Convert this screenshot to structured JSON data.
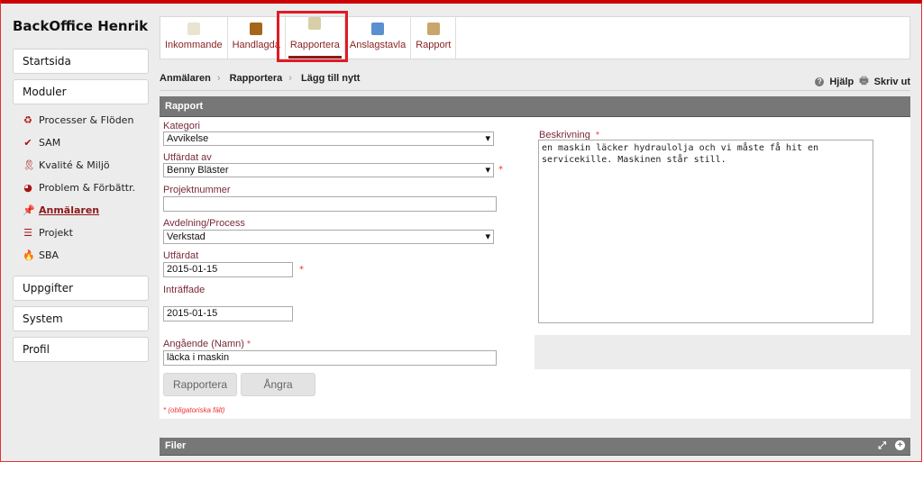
{
  "app_title": "BackOffice Henrik",
  "sidebar": {
    "startsida": "Startsida",
    "moduler": "Moduler",
    "modules": [
      {
        "label": "Processer & Flöden",
        "icon": "recycle-icon"
      },
      {
        "label": "SAM",
        "icon": "checkmark-icon"
      },
      {
        "label": "Kvalité & Miljö",
        "icon": "ribbon-icon"
      },
      {
        "label": "Problem & Förbättr.",
        "icon": "pie-chart-icon"
      },
      {
        "label": "Anmälaren",
        "icon": "pin-icon",
        "active": true
      },
      {
        "label": "Projekt",
        "icon": "gantt-icon"
      },
      {
        "label": "SBA",
        "icon": "fire-icon"
      }
    ],
    "uppgifter": "Uppgifter",
    "system": "System",
    "profil": "Profil"
  },
  "toolbar": {
    "tabs": [
      {
        "label": "Inkommande",
        "icon": "incoming-mail-icon"
      },
      {
        "label": "Handlagda",
        "icon": "binder-icon"
      },
      {
        "label": "Rapportera",
        "icon": "report-edit-icon",
        "selected": true
      },
      {
        "label": "Anslagstavla",
        "icon": "notice-board-icon"
      },
      {
        "label": "Rapport",
        "icon": "clipboard-icon"
      }
    ]
  },
  "breadcrumb": [
    "Anmälaren",
    "Rapportera",
    "Lägg till nytt"
  ],
  "tools": {
    "help": "Hjälp",
    "print": "Skriv ut"
  },
  "form": {
    "section_title": "Rapport",
    "kategori_label": "Kategori",
    "kategori_value": "Avvikelse",
    "utfardat_av_label": "Utfärdat av",
    "utfardat_av_value": "Benny Bläster",
    "projektnummer_label": "Projektnummer",
    "projektnummer_value": "",
    "avdelning_label": "Avdelning/Process",
    "avdelning_value": "Verkstad",
    "utfardat_label": "Utfärdat",
    "utfardat_value": "2015-01-15",
    "intraffade_label": "Inträffade",
    "intraffade_value": "2015-01-15",
    "angaende_label": "Angående (Namn)",
    "angaende_value": "läcka i maskin",
    "beskrivning_label": "Beskrivning",
    "beskrivning_value": "en maskin läcker hydraulolja och vi måste få hit en servicekille. Maskinen står still.",
    "required_mark": "*",
    "submit": "Rapportera",
    "cancel": "Ångra",
    "required_note": "* (obligatoriska fält)"
  },
  "files": {
    "title": "Filer"
  },
  "colors": {
    "accent": "#8b1a1a",
    "highlight": "#e01b24",
    "bar": "#777777"
  }
}
